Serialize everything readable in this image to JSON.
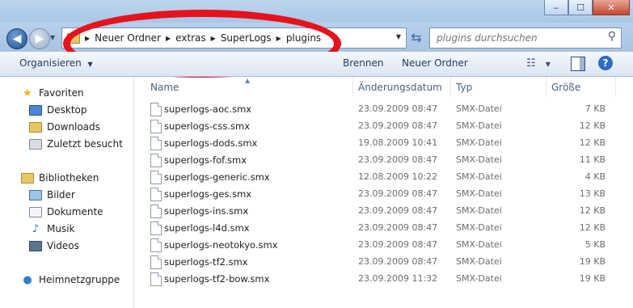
{
  "window": {
    "minimize_glyph": "‒",
    "maximize_glyph": "☐",
    "close_glyph": "✕"
  },
  "address": {
    "crumbs": [
      "Neuer Ordner",
      "extras",
      "SuperLogs",
      "plugins"
    ]
  },
  "search": {
    "placeholder": "plugins durchsuchen"
  },
  "toolbar": {
    "organize_label": "Organisieren",
    "organize_arrow": "▼",
    "burn_label": "Brennen",
    "new_folder_label": "Neuer Ordner",
    "help_label": "?"
  },
  "nav": {
    "favorites_label": "Favoriten",
    "favorites": [
      "Desktop",
      "Downloads",
      "Zuletzt besucht"
    ],
    "libraries_label": "Bibliotheken",
    "libraries": [
      "Bilder",
      "Dokumente",
      "Musik",
      "Videos"
    ],
    "homegroup_label": "Heimnetzgruppe"
  },
  "columns": {
    "name": "Name",
    "date": "Änderungsdatum",
    "type": "Typ",
    "size": "Größe"
  },
  "files": [
    {
      "name": "superlogs-aoc.smx",
      "date": "23.09.2009 08:47",
      "type": "SMX-Datei",
      "size": "7 KB"
    },
    {
      "name": "superlogs-css.smx",
      "date": "23.09.2009 08:47",
      "type": "SMX-Datei",
      "size": "12 KB"
    },
    {
      "name": "superlogs-dods.smx",
      "date": "19.08.2009 10:41",
      "type": "SMX-Datei",
      "size": "12 KB"
    },
    {
      "name": "superlogs-fof.smx",
      "date": "23.09.2009 08:47",
      "type": "SMX-Datei",
      "size": "11 KB"
    },
    {
      "name": "superlogs-generic.smx",
      "date": "12.08.2009 10:22",
      "type": "SMX-Datei",
      "size": "4 KB"
    },
    {
      "name": "superlogs-ges.smx",
      "date": "23.09.2009 08:47",
      "type": "SMX-Datei",
      "size": "13 KB"
    },
    {
      "name": "superlogs-ins.smx",
      "date": "23.09.2009 08:47",
      "type": "SMX-Datei",
      "size": "12 KB"
    },
    {
      "name": "superlogs-l4d.smx",
      "date": "23.09.2009 08:47",
      "type": "SMX-Datei",
      "size": "12 KB"
    },
    {
      "name": "superlogs-neotokyo.smx",
      "date": "23.09.2009 08:47",
      "type": "SMX-Datei",
      "size": "5 KB"
    },
    {
      "name": "superlogs-tf2.smx",
      "date": "23.09.2009 08:47",
      "type": "SMX-Datei",
      "size": "19 KB"
    },
    {
      "name": "superlogs-tf2-bow.smx",
      "date": "23.09.2009 11:32",
      "type": "SMX-Datei",
      "size": "19 KB"
    }
  ],
  "colors": {
    "annotation": "#e6121c",
    "frame": "#a9c7e6"
  }
}
